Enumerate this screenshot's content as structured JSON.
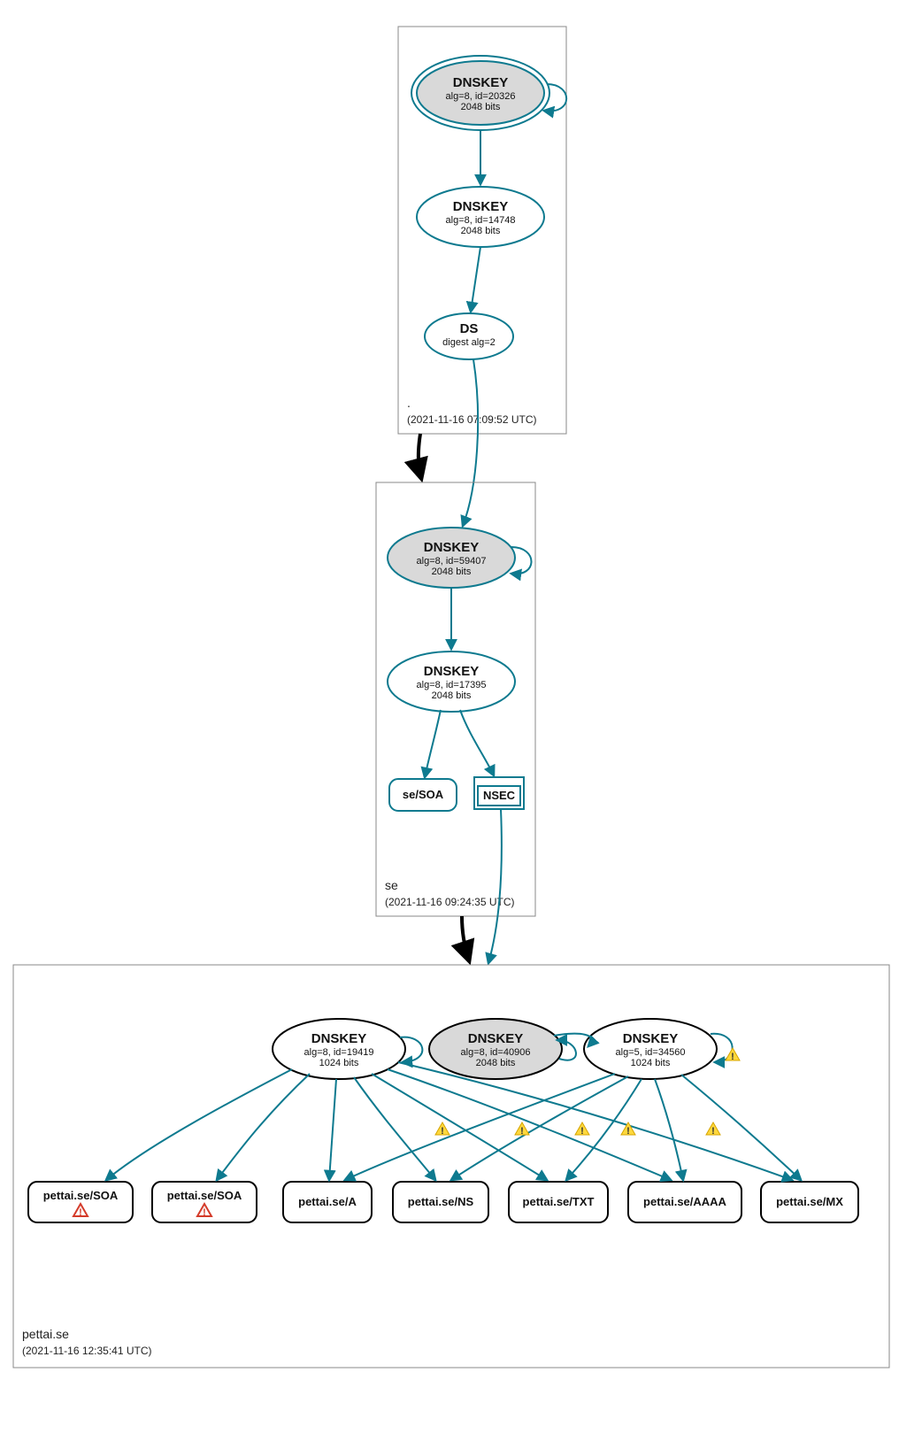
{
  "zones": {
    "root": {
      "label": ".",
      "timestamp": "(2021-11-16 07:09:52 UTC)"
    },
    "se": {
      "label": "se",
      "timestamp": "(2021-11-16 09:24:35 UTC)"
    },
    "pettai": {
      "label": "pettai.se",
      "timestamp": "(2021-11-16 12:35:41 UTC)"
    }
  },
  "nodes": {
    "root_ksk": {
      "title": "DNSKEY",
      "line2": "alg=8, id=20326",
      "line3": "2048 bits"
    },
    "root_zsk": {
      "title": "DNSKEY",
      "line2": "alg=8, id=14748",
      "line3": "2048 bits"
    },
    "root_ds": {
      "title": "DS",
      "line2": "digest alg=2"
    },
    "se_ksk": {
      "title": "DNSKEY",
      "line2": "alg=8, id=59407",
      "line3": "2048 bits"
    },
    "se_zsk": {
      "title": "DNSKEY",
      "line2": "alg=8, id=17395",
      "line3": "2048 bits"
    },
    "se_soa": {
      "title": "se/SOA"
    },
    "se_nsec": {
      "title": "NSEC"
    },
    "p_k1": {
      "title": "DNSKEY",
      "line2": "alg=8, id=19419",
      "line3": "1024 bits"
    },
    "p_k2": {
      "title": "DNSKEY",
      "line2": "alg=8, id=40906",
      "line3": "2048 bits"
    },
    "p_k3": {
      "title": "DNSKEY",
      "line2": "alg=5, id=34560",
      "line3": "1024 bits"
    },
    "leaf_soa1": {
      "title": "pettai.se/SOA"
    },
    "leaf_soa2": {
      "title": "pettai.se/SOA"
    },
    "leaf_a": {
      "title": "pettai.se/A"
    },
    "leaf_ns": {
      "title": "pettai.se/NS"
    },
    "leaf_txt": {
      "title": "pettai.se/TXT"
    },
    "leaf_aaaa": {
      "title": "pettai.se/AAAA"
    },
    "leaf_mx": {
      "title": "pettai.se/MX"
    }
  }
}
